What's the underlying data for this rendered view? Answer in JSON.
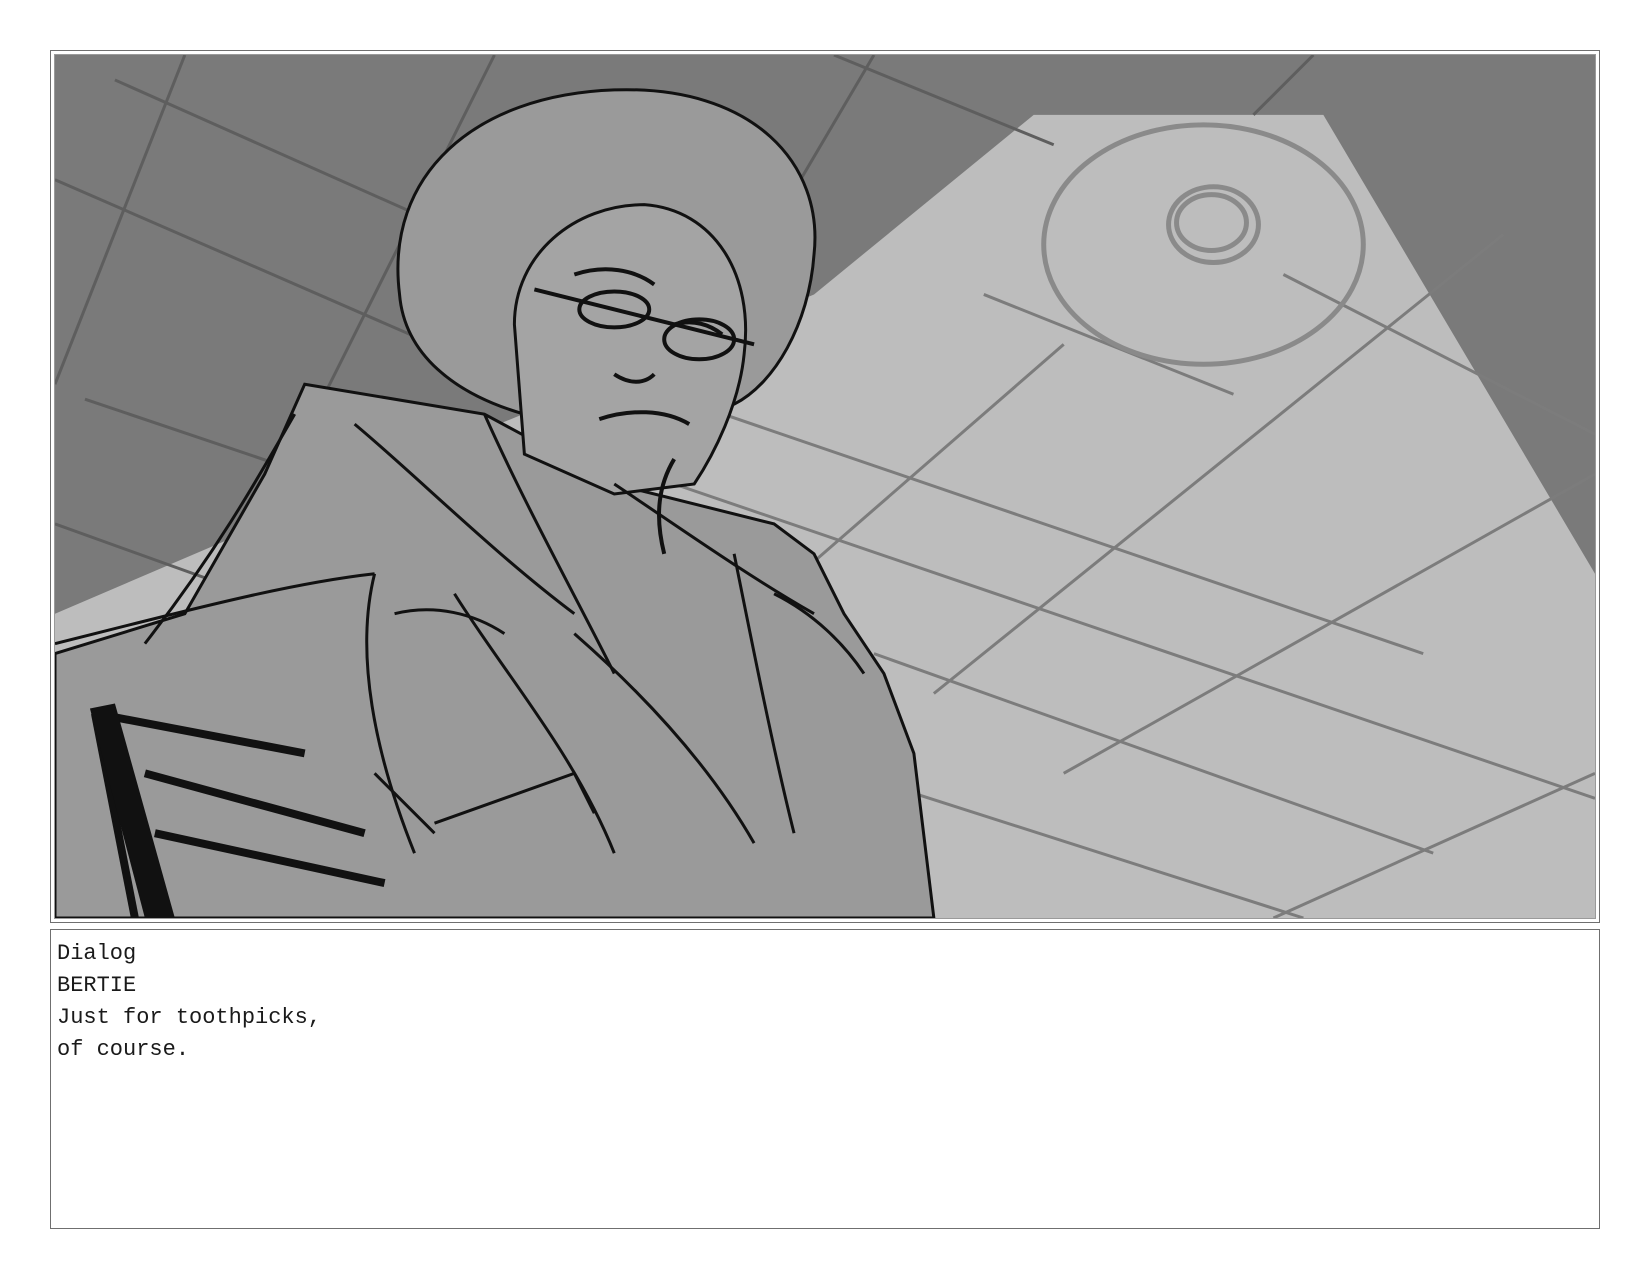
{
  "panel": {
    "image_description": "storyboard-sketch",
    "colors": {
      "ceiling_dark": "#7a7a7a",
      "light_cone": "#bdbdbd",
      "figure_fill": "#9a9a9a",
      "ink": "#111111",
      "grid_line": "#6a6a6a"
    }
  },
  "notes": {
    "section_label": "Dialog",
    "character": "BERTIE",
    "line_1": "Just for toothpicks,",
    "line_2": "of course."
  }
}
